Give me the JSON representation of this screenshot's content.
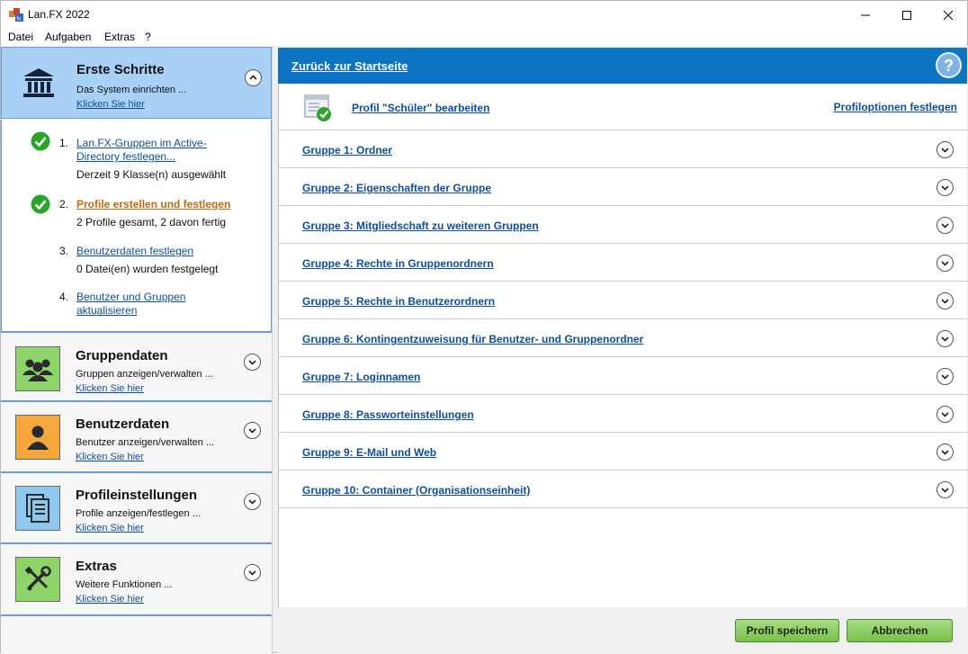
{
  "window": {
    "title": "Lan.FX 2022"
  },
  "menu": [
    "Datei",
    "Aufgaben",
    "Extras",
    "?"
  ],
  "left": {
    "first": {
      "title": "Erste Schritte",
      "subtitle": "Das System einrichten ...",
      "link": "Klicken Sie hier",
      "steps": [
        {
          "num": "1.",
          "link_line1": "Lan.FX-Gruppen im Active-",
          "link_line2": "Directory festlegen...",
          "info": "Derzeit 9 Klasse(n) ausgewählt",
          "done": true
        },
        {
          "num": "2.",
          "link_line1": "Profile erstellen und festlegen",
          "link_line2": "",
          "info": "2 Profile gesamt, 2 davon fertig",
          "done": true,
          "active": true
        },
        {
          "num": "3.",
          "link_line1": "Benutzerdaten festlegen",
          "link_line2": "",
          "info": "0 Datei(en) wurden festgelegt",
          "done": false
        },
        {
          "num": "4.",
          "link_line1": "Benutzer und Gruppen",
          "link_line2": "aktualisieren",
          "info": "",
          "done": false
        }
      ]
    },
    "sections": [
      {
        "title": "Gruppendaten",
        "subtitle": "Gruppen anzeigen/verwalten ...",
        "link": "Klicken Sie hier",
        "icon": "users-icon",
        "color": "#8fd46a"
      },
      {
        "title": "Benutzerdaten",
        "subtitle": "Benutzer anzeigen/verwalten ...",
        "link": "Klicken Sie hier",
        "icon": "user-icon",
        "color": "#f5a63c"
      },
      {
        "title": "Profileinstellungen",
        "subtitle": "Profile anzeigen/festlegen ...",
        "link": "Klicken Sie hier",
        "icon": "document-icon",
        "color": "#8ec8ef"
      },
      {
        "title": "Extras",
        "subtitle": "Weitere Funktionen ...",
        "link": "Klicken Sie hier",
        "icon": "tools-icon",
        "color": "#8fd46a"
      }
    ]
  },
  "right": {
    "back_link": "Zurück zur Startseite",
    "profile_link": "Profil \"Schüler\" bearbeiten",
    "profile_options": "Profiloptionen festlegen",
    "groups": [
      "Gruppe 1: Ordner",
      "Gruppe 2: Eigenschaften der Gruppe",
      "Gruppe 3: Mitgliedschaft zu weiteren Gruppen",
      "Gruppe 4: Rechte in Gruppenordnern",
      "Gruppe 5: Rechte in Benutzerordnern",
      "Gruppe 6: Kontingentzuweisung für Benutzer- und Gruppenordner",
      "Gruppe 7: Loginnamen",
      "Gruppe 8: Passworteinstellungen",
      "Gruppe 9: E-Mail und Web",
      "Gruppe 10: Container (Organisationseinheit)"
    ],
    "save_button": "Profil speichern",
    "cancel_button": "Abbrechen"
  }
}
